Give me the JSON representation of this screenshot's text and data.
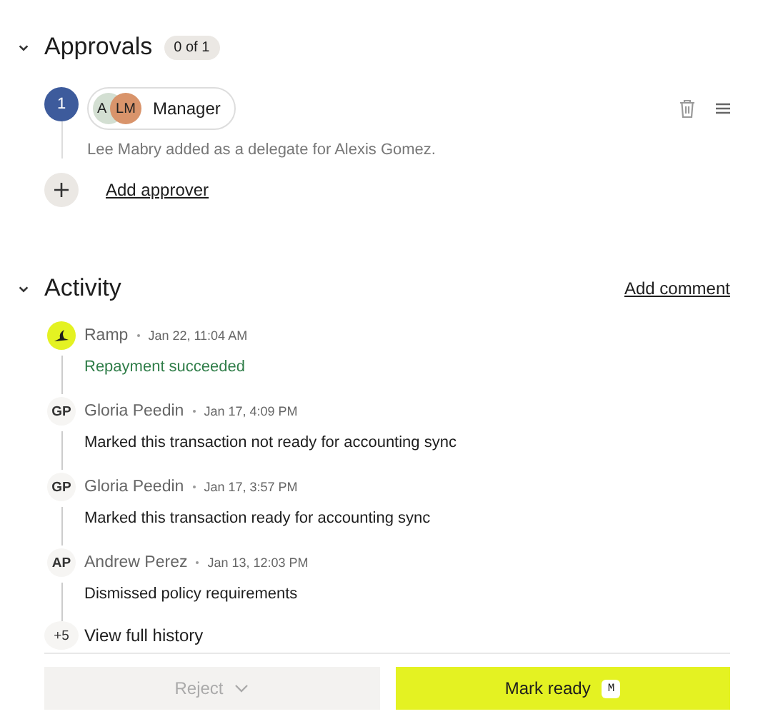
{
  "approvals": {
    "title": "Approvals",
    "count": "0 of 1",
    "expanded": true,
    "steps": [
      {
        "number": "1",
        "avatars": [
          {
            "initials": "A",
            "color": "#d3dfd2"
          },
          {
            "initials": "LM",
            "color": "#d9946b"
          }
        ],
        "label": "Manager",
        "note": "Lee Mabry added as a delegate for Alexis Gomez."
      }
    ],
    "add_label": "Add approver"
  },
  "activity": {
    "title": "Activity",
    "expanded": true,
    "add_comment": "Add comment",
    "items": [
      {
        "kind": "system",
        "author": "Ramp",
        "time": "Jan 22, 11:04 AM",
        "message": "Repayment succeeded"
      },
      {
        "kind": "user",
        "initials": "GP",
        "author": "Gloria Peedin",
        "time": "Jan 17, 4:09 PM",
        "message": "Marked this transaction not ready for accounting sync"
      },
      {
        "kind": "user",
        "initials": "GP",
        "author": "Gloria Peedin",
        "time": "Jan 17, 3:57 PM",
        "message": "Marked this transaction ready for accounting sync"
      },
      {
        "kind": "user",
        "initials": "AP",
        "author": "Andrew Perez",
        "time": "Jan 13, 12:03 PM",
        "message": "Dismissed policy requirements"
      }
    ],
    "more_count": "+5",
    "more_label": "View full history"
  },
  "footer": {
    "reject": {
      "label": "Reject",
      "disabled": true
    },
    "primary": {
      "label": "Mark ready",
      "shortcut": "M"
    }
  }
}
